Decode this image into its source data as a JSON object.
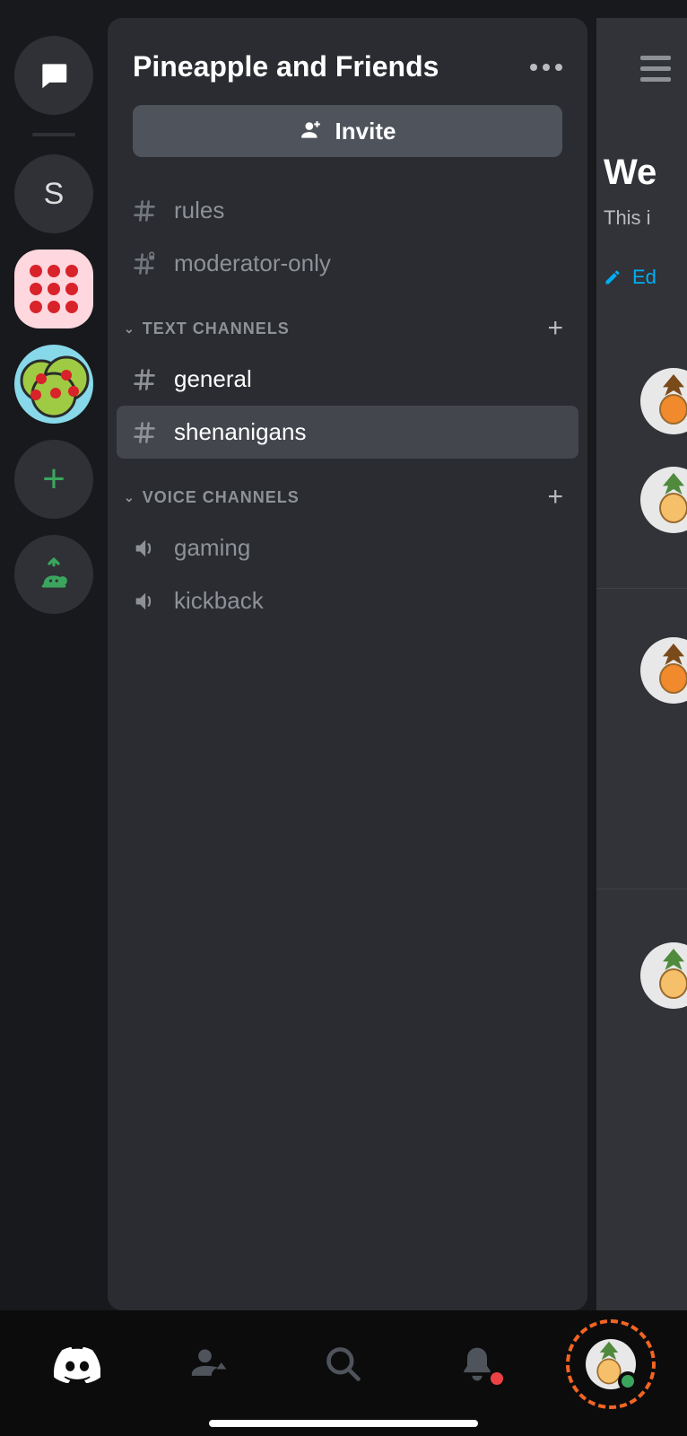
{
  "server": {
    "title": "Pineapple and Friends",
    "invite_label": "Invite"
  },
  "server_rail": {
    "dm_label": "",
    "items": [
      {
        "letter": "S"
      }
    ]
  },
  "pinned_channels": [
    {
      "name": "rules",
      "locked": false
    },
    {
      "name": "moderator-only",
      "locked": true
    }
  ],
  "categories": [
    {
      "label": "TEXT CHANNELS",
      "type": "text",
      "channels": [
        {
          "name": "general",
          "unread": true,
          "selected": false
        },
        {
          "name": "shenanigans",
          "unread": false,
          "selected": true
        }
      ]
    },
    {
      "label": "VOICE CHANNELS",
      "type": "voice",
      "channels": [
        {
          "name": "gaming"
        },
        {
          "name": "kickback"
        }
      ]
    }
  ],
  "peek": {
    "welcome_fragment": "We",
    "subtitle_fragment": "This i",
    "edit_fragment": "Ed"
  },
  "colors": {
    "accent_green": "#3ba55d",
    "accent_red": "#ed4245",
    "link_blue": "#00aff4",
    "highlight_orange": "#f26522"
  }
}
